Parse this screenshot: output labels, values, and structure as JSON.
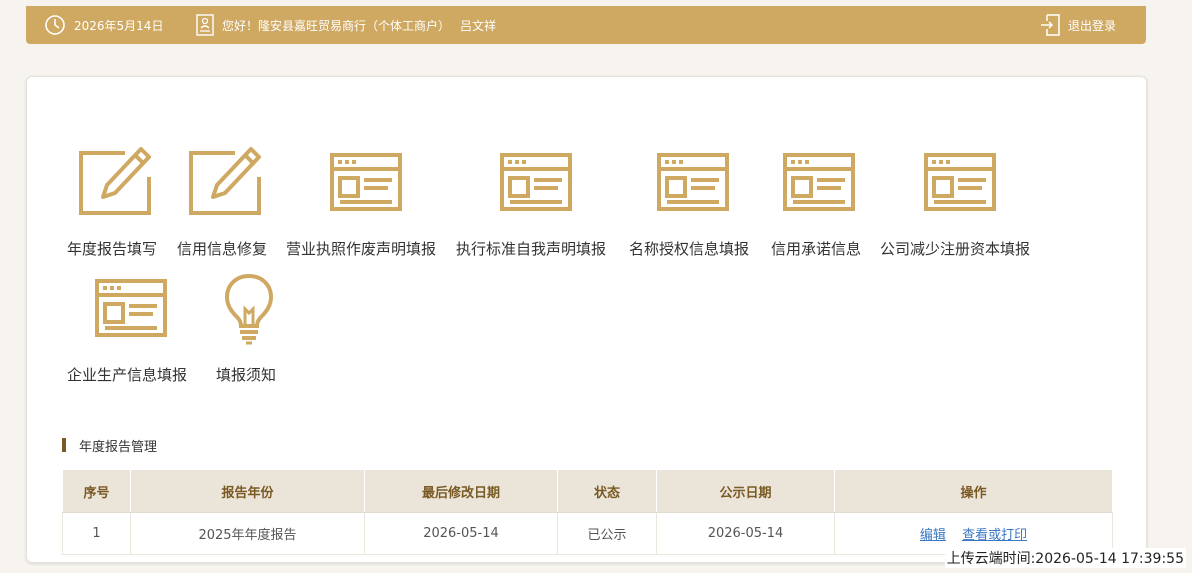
{
  "header": {
    "date": "2026年5月14日",
    "greeting": "您好！隆安县嘉旺贸易商行（个体工商户）",
    "user_name": "吕文祥",
    "logout": "退出登录"
  },
  "tiles": [
    {
      "label": "年度报告填写",
      "icon": "edit-icon"
    },
    {
      "label": "信用信息修复",
      "icon": "edit-icon"
    },
    {
      "label": "营业执照作废声明填报",
      "icon": "form-window-icon"
    },
    {
      "label": "执行标准自我声明填报",
      "icon": "form-window-icon"
    },
    {
      "label": "名称授权信息填报",
      "icon": "form-window-icon"
    },
    {
      "label": "信用承诺信息",
      "icon": "form-window-icon"
    },
    {
      "label": "公司减少注册资本填报",
      "icon": "form-window-icon"
    },
    {
      "label": "企业生产信息填报",
      "icon": "form-window-icon"
    },
    {
      "label": "填报须知",
      "icon": "lightbulb-icon"
    }
  ],
  "section": {
    "title": "年度报告管理"
  },
  "table": {
    "columns": [
      "序号",
      "报告年份",
      "最后修改日期",
      "状态",
      "公示日期",
      "操作"
    ],
    "rows": [
      {
        "index": "1",
        "year": "2025年年度报告",
        "modified": "2026-05-14",
        "status": "已公示",
        "publish_date": "2026-05-14",
        "actions": [
          "编辑",
          "查看或打印"
        ]
      }
    ]
  },
  "footer": {
    "upload_time": "上传云端时间:2026-05-14 17:39:55"
  },
  "colors": {
    "accent": "#cfa862",
    "header_text": "#7a5a24",
    "link": "#3a78c4"
  }
}
